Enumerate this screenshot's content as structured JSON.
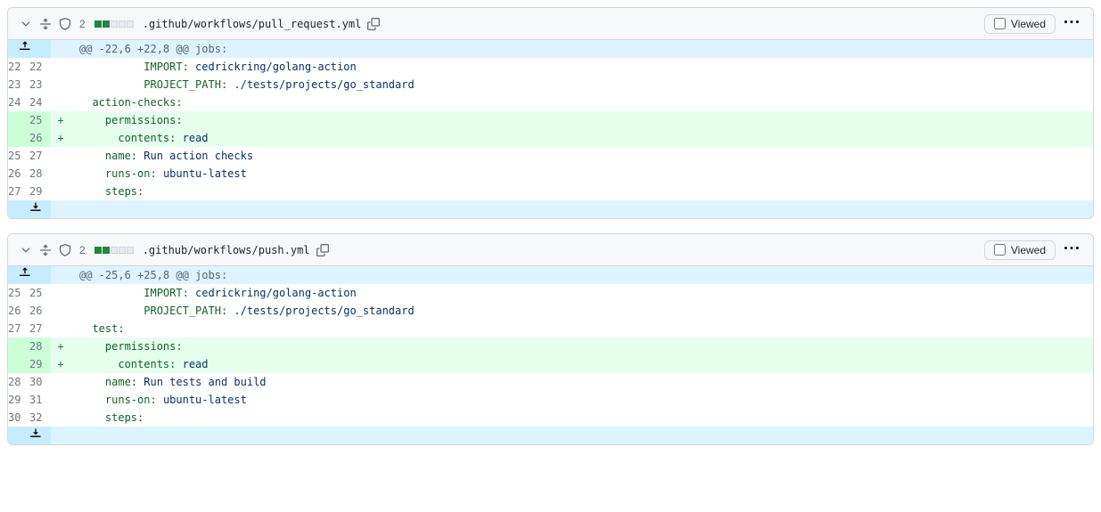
{
  "viewed_label": "Viewed",
  "files": [
    {
      "changes": "2",
      "stat_adds": 2,
      "stat_neutral": 3,
      "path": ".github/workflows/pull_request.yml",
      "hunk_header": "@@ -22,6 +22,8 @@ jobs:",
      "rows": [
        {
          "type": "ctx",
          "old": "22",
          "new": "22",
          "text": "          IMPORT: cedrickring/golang-action"
        },
        {
          "type": "ctx",
          "old": "23",
          "new": "23",
          "text": "          PROJECT_PATH: ./tests/projects/go_standard"
        },
        {
          "type": "ctx",
          "old": "24",
          "new": "24",
          "text": "  action-checks:"
        },
        {
          "type": "add",
          "old": "",
          "new": "25",
          "text": "    permissions:"
        },
        {
          "type": "add",
          "old": "",
          "new": "26",
          "text": "      contents: read"
        },
        {
          "type": "ctx",
          "old": "25",
          "new": "27",
          "text": "    name: Run action checks"
        },
        {
          "type": "ctx",
          "old": "26",
          "new": "28",
          "text": "    runs-on: ubuntu-latest"
        },
        {
          "type": "ctx",
          "old": "27",
          "new": "29",
          "text": "    steps:"
        }
      ]
    },
    {
      "changes": "2",
      "stat_adds": 2,
      "stat_neutral": 3,
      "path": ".github/workflows/push.yml",
      "hunk_header": "@@ -25,6 +25,8 @@ jobs:",
      "rows": [
        {
          "type": "ctx",
          "old": "25",
          "new": "25",
          "text": "          IMPORT: cedrickring/golang-action"
        },
        {
          "type": "ctx",
          "old": "26",
          "new": "26",
          "text": "          PROJECT_PATH: ./tests/projects/go_standard"
        },
        {
          "type": "ctx",
          "old": "27",
          "new": "27",
          "text": "  test:"
        },
        {
          "type": "add",
          "old": "",
          "new": "28",
          "text": "    permissions:"
        },
        {
          "type": "add",
          "old": "",
          "new": "29",
          "text": "      contents: read"
        },
        {
          "type": "ctx",
          "old": "28",
          "new": "30",
          "text": "    name: Run tests and build"
        },
        {
          "type": "ctx",
          "old": "29",
          "new": "31",
          "text": "    runs-on: ubuntu-latest"
        },
        {
          "type": "ctx",
          "old": "30",
          "new": "32",
          "text": "    steps:"
        }
      ]
    }
  ]
}
